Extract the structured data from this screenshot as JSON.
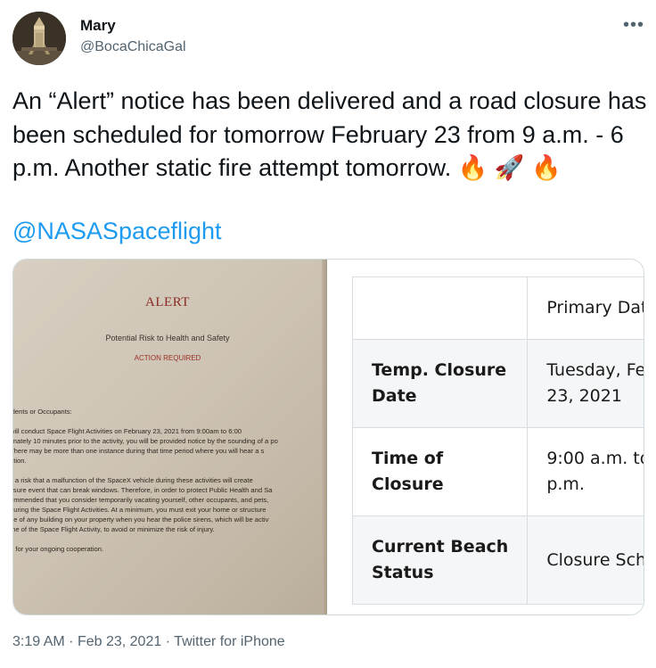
{
  "author": {
    "name": "Mary",
    "handle": "@BocaChicaGal",
    "avatar_icon": "starship-photo-avatar"
  },
  "tweet": {
    "text": "An “Alert” notice has been delivered and a road closure has been scheduled for tomorrow February 23 from 9 a.m. - 6 p.m. Another static fire attempt tomorrow.",
    "emojis": [
      "🔥",
      "🚀",
      "🔥"
    ],
    "mention": "@NASASpaceflight"
  },
  "photo_doc": {
    "title": "ALERT",
    "subtitle": "Potential Risk to Health and Safety",
    "action": "ACTION REQUIRED",
    "lines": [
      "idents or Occupants:",
      " will conduct Space Flight Activities on February 23, 2021 from 9:00am to 6:00",
      "imately 10 minutes prior to the activity, you will be provided notice by the sounding of a po",
      "There may be more than one instance during that time period where you will hear a s",
      "ation.",
      "s a risk that a malfunction of the SpaceX vehicle during these activities will create",
      "ssure event that can break windows. Therefore, in order to protect Public Health and Sa",
      "ommended that you consider temporarily vacating yourself, other occupants, and pets,",
      "during the Space Flight Activities. At a minimum, you must exit your home or structure",
      "de of any building on your property when you hear the police sirens, which will be activ",
      "me of the Space Flight Activity, to avoid or minimize the risk of injury.",
      "u for your ongoing cooperation."
    ]
  },
  "closure_table": {
    "header": "Primary Dat",
    "rows": [
      {
        "label_line1": "Temp. Closure",
        "label_line2": "Date",
        "value_line1": "Tuesday, Fe",
        "value_line2": "23, 2021"
      },
      {
        "label_line1": "Time of",
        "label_line2": "Closure",
        "value_line1": "9:00 a.m. to",
        "value_line2": "p.m."
      },
      {
        "label_line1": "Current Beach",
        "label_line2": "Status",
        "value_line1": "Closure Sch",
        "value_line2": ""
      }
    ]
  },
  "meta": {
    "time": "3:19 AM",
    "separator": "·",
    "date": "Feb 23, 2021",
    "source": "Twitter for iPhone"
  },
  "colors": {
    "link": "#1d9bf0",
    "secondary_text": "#536471",
    "alert_red": "#8b2a22"
  }
}
